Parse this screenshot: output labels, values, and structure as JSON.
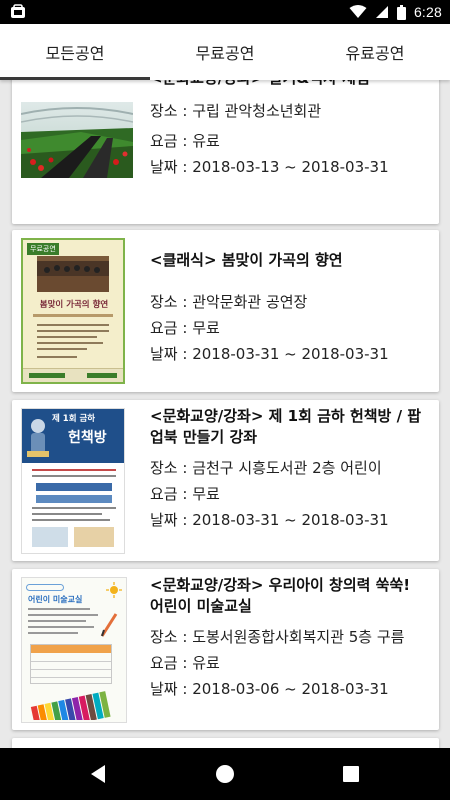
{
  "status_bar": {
    "time": "6:28",
    "icons": [
      "app-notification-icon",
      "wifi-icon",
      "signal-icon",
      "battery-icon"
    ]
  },
  "tabs": [
    {
      "label": "모든공연",
      "selected": true
    },
    {
      "label": "무료공연",
      "selected": false
    },
    {
      "label": "유료공연",
      "selected": false
    }
  ],
  "events": [
    {
      "title": "<문화교양/강좌> 딸기&역사 체험",
      "place": "장소 : 구립 관악청소년회관",
      "fee": "요금 : 유료",
      "date": "날짜 : 2018-03-13 ~ 2018-03-31"
    },
    {
      "title": "<클래식> 봄맞이 가곡의 향연",
      "place": "장소 : 관악문화관 공연장",
      "fee": "요금 : 무료",
      "date": "날짜 : 2018-03-31 ~ 2018-03-31"
    },
    {
      "title": "<문화교양/강좌> 제 1회 금하 헌책방 / 팝업북 만들기 강좌",
      "place": "장소 : 금천구 시흥도서관 2층 어린이",
      "fee": "요금 : 무료",
      "date": "날짜 : 2018-03-31 ~ 2018-03-31"
    },
    {
      "title": "<문화교양/강좌> 우리아이 창의력 쑥쑥! 어린이 미술교실",
      "place": "장소 : 도봉서원종합사회복지관 5층 구름",
      "fee": "요금 : 유료",
      "date": "날짜 : 2018-03-06 ~ 2018-03-31"
    }
  ],
  "posters": {
    "concert": {
      "banner": "무료공연",
      "headline": "봄맞이 가곡의 향연"
    },
    "bookshop": {
      "headline_top": "제 1회 금하",
      "headline_bottom": "헌책방"
    },
    "art": {
      "headline": "어린이 미술교실"
    }
  },
  "nav": [
    "back-icon",
    "home-icon",
    "recents-icon"
  ]
}
